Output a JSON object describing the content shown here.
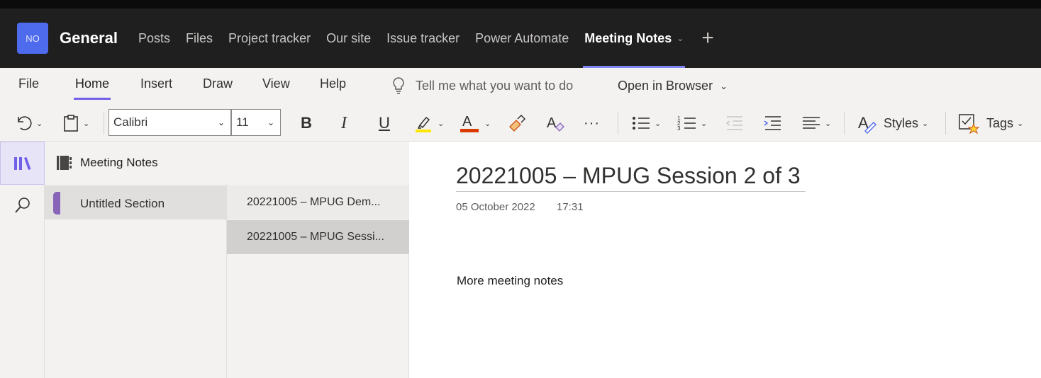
{
  "team": {
    "initials": "NO",
    "name": "General",
    "avatar_color": "#4f6bed"
  },
  "channel_tabs": [
    {
      "label": "Posts"
    },
    {
      "label": "Files"
    },
    {
      "label": "Project tracker"
    },
    {
      "label": "Our site"
    },
    {
      "label": "Issue tracker"
    },
    {
      "label": "Power Automate"
    },
    {
      "label": "Meeting Notes",
      "active": true
    }
  ],
  "ribbon": {
    "menu": [
      "File",
      "Home",
      "Insert",
      "Draw",
      "View",
      "Help"
    ],
    "active_menu": "Home",
    "tell_me_placeholder": "Tell me what you want to do",
    "open_in_browser": "Open in Browser"
  },
  "toolbar": {
    "font_family": "Calibri",
    "font_size": "11",
    "bold": "B",
    "italic": "I",
    "underline": "U",
    "more": "···",
    "styles_label": "Styles",
    "tags_label": "Tags",
    "highlight_color": "#ffe600",
    "font_color": "#d83b01"
  },
  "notebook": {
    "title": "Meeting Notes",
    "sections": [
      {
        "label": "Untitled Section",
        "color": "#8764b8",
        "selected": true
      }
    ],
    "pages": [
      {
        "label": "20221005 – MPUG Dem..."
      },
      {
        "label": "20221005 – MPUG Sessi...",
        "selected": true
      }
    ]
  },
  "page": {
    "title": "20221005 – MPUG Session 2 of 3",
    "date": "05 October 2022",
    "time": "17:31",
    "body": "More meeting notes"
  },
  "accent_color": "#7f85f5"
}
